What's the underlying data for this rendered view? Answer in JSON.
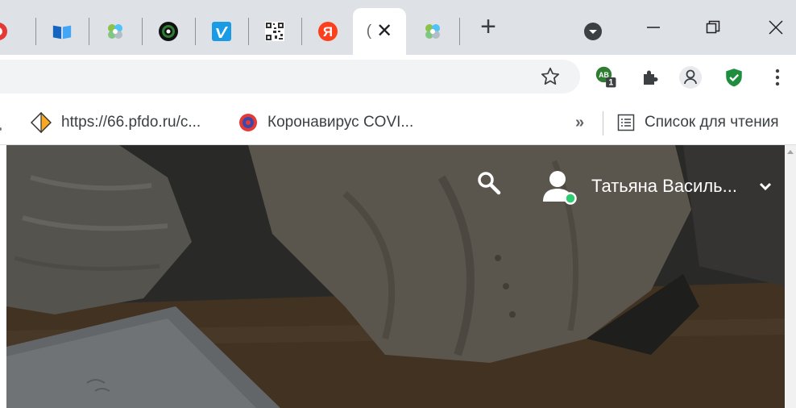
{
  "tabs": [
    {
      "name": "red-partial",
      "icon": "red-circle-icon"
    },
    {
      "name": "book",
      "icon": "book-icon"
    },
    {
      "name": "flower-1",
      "icon": "flower-icon"
    },
    {
      "name": "record",
      "icon": "record-icon"
    },
    {
      "name": "vimeo",
      "icon": "vimeo-icon"
    },
    {
      "name": "qr",
      "icon": "qr-code-icon"
    },
    {
      "name": "yandex",
      "icon": "yandex-icon",
      "glyph": "Я"
    },
    {
      "name": "active",
      "icon": "loading-icon",
      "partial_text": "("
    },
    {
      "name": "flower-2",
      "icon": "flower-icon"
    }
  ],
  "tabstrip": {
    "new_tab": "+",
    "close": "✕"
  },
  "extensions": {
    "badge_count": "1",
    "ext_label": "AB"
  },
  "bookmarks": {
    "items": [
      {
        "label": "https://66.pfdo.ru/c...",
        "icon": "diamond-icon"
      },
      {
        "label": "Коронавирус COVI...",
        "icon": "virus-icon"
      }
    ],
    "overflow": "»",
    "reading_list": "Список для чтения"
  },
  "page": {
    "user_name": "Татьяна Василь...",
    "status_color": "#2ecc71"
  },
  "colors": {
    "tabstrip_bg": "#dee1e6",
    "omnibox_bg": "#f1f3f4",
    "shield_green": "#1e8e3e",
    "yandex_red": "#fc3f1d",
    "vimeo_blue": "#1a9be5"
  }
}
